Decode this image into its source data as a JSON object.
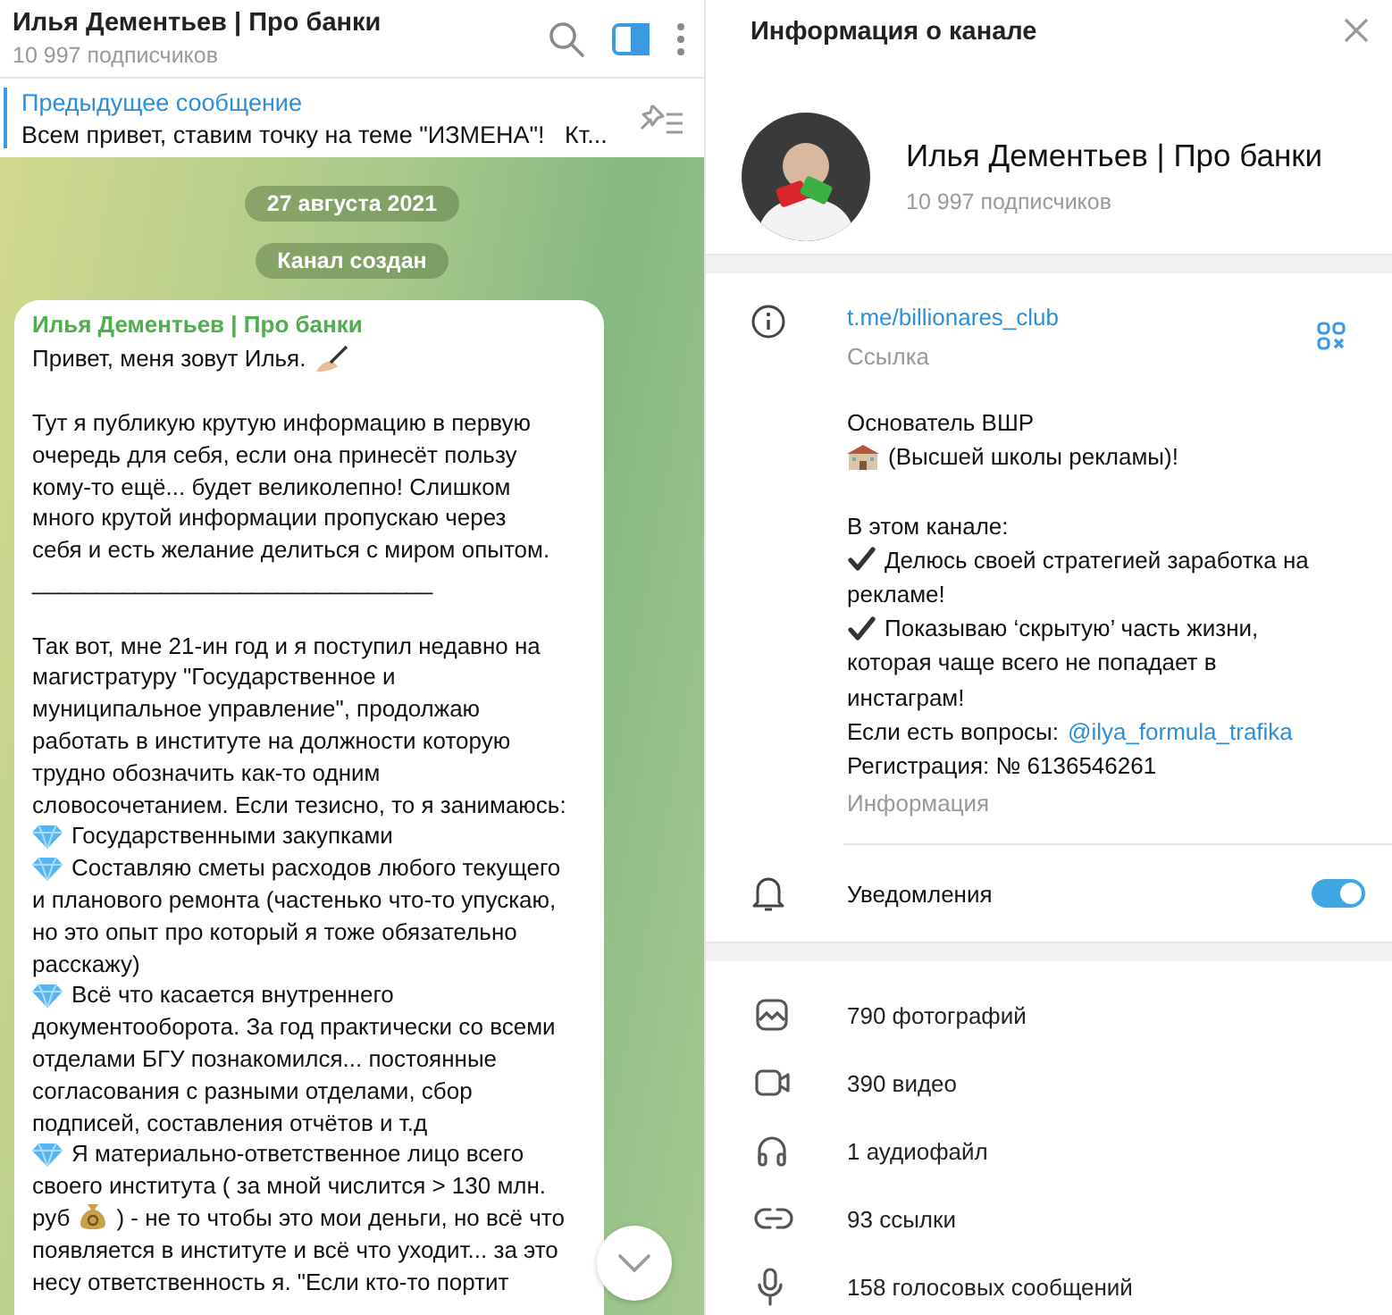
{
  "chat": {
    "title": "Илья Дементьев | Про банки",
    "subtitle": "10 997 подписчиков",
    "info_panel_open": true,
    "pinned": {
      "label": "Предыдущее сообщение",
      "text": "Всем привет, ставим точку на теме \"ИЗМЕНА\"!   Кт..."
    },
    "service_messages": [
      "27 августа 2021",
      "Канал создан"
    ],
    "message": {
      "author": "Илья Дементьев | Про банки",
      "paragraphs": [
        [
          {
            "kind": "hand",
            "text": "Привет, меня зовут Илья."
          }
        ],
        [
          {
            "kind": "text",
            "text": "Тут я публикую крутую информацию в первую"
          },
          {
            "kind": "text",
            "text": "очередь для себя, если она принесёт пользу"
          },
          {
            "kind": "text",
            "text": "кому-то ещё... будет великолепно! Слишком"
          },
          {
            "kind": "text",
            "text": "много крутой информации пропускаю через"
          },
          {
            "kind": "text",
            "text": "себя и есть желание делиться с миром опытом."
          },
          {
            "kind": "text",
            "text": "_______________________________"
          }
        ],
        [
          {
            "kind": "text",
            "text": "Так вот, мне 21-ин год и я поступил недавно на"
          },
          {
            "kind": "text",
            "text": "магистратуру \"Государственное и"
          },
          {
            "kind": "text",
            "text": "муниципальное управление\", продолжаю"
          },
          {
            "kind": "text",
            "text": "работать в институте на должности которую"
          },
          {
            "kind": "text",
            "text": "трудно обозначить как-то одним"
          },
          {
            "kind": "text",
            "text": "словосочетанием. Если тезисно, то я занимаюсь:"
          },
          {
            "kind": "bullet",
            "text": "Государственными закупками"
          },
          {
            "kind": "bullet",
            "text": "Составляю сметы расходов любого текущего"
          },
          {
            "kind": "text",
            "text": "и планового ремонта (частенько что-то упускаю,"
          },
          {
            "kind": "text",
            "text": "но это опыт про который я тоже обязательно"
          },
          {
            "kind": "text",
            "text": "расскажу)"
          },
          {
            "kind": "bullet",
            "text": "Всё что касается внутреннего"
          },
          {
            "kind": "text",
            "text": "документооборота. За год практически со всеми"
          },
          {
            "kind": "text",
            "text": "отделами БГУ познакомился... постоянные"
          },
          {
            "kind": "text",
            "text": "согласования с разными отделами, сбор"
          },
          {
            "kind": "text",
            "text": "подписей, составления отчётов и т.д"
          },
          {
            "kind": "bullet",
            "text": "Я материально-ответственное лицо всего"
          },
          {
            "kind": "text",
            "text": "своего института ( за мной числится > 130 млн."
          },
          {
            "kind": "money",
            "before": "руб",
            "after": ") - не то чтобы это мои деньги, но всё что"
          },
          {
            "kind": "text",
            "text": "появляется в институте и всё что уходит... за это"
          },
          {
            "kind": "text",
            "text": "несу ответственность я. \"Если кто-то портит"
          }
        ]
      ]
    }
  },
  "info": {
    "title": "Информация о канале",
    "channel": {
      "name": "Илья Дементьев | Про банки",
      "subscribers": "10 997 подписчиков"
    },
    "link": {
      "url": "t.me/billionares_club",
      "label": "Ссылка"
    },
    "description": {
      "paragraphs": [
        [
          {
            "kind": "text",
            "text": "Основатель ВШР"
          },
          {
            "kind": "school",
            "text": "(Высшей школы рекламы)!"
          }
        ],
        [
          {
            "kind": "text",
            "text": "В этом канале:"
          },
          {
            "kind": "check",
            "text": "Делюсь своей стратегией заработка на"
          },
          {
            "kind": "text",
            "text": "рекламе!"
          },
          {
            "kind": "check",
            "text": "Показываю ‘скрытую’ часть жизни,"
          },
          {
            "kind": "text",
            "text": "которая чаще всего не попадает в"
          },
          {
            "kind": "text",
            "text": "инстаграм!"
          },
          {
            "kind": "mention",
            "text": "Если есть вопросы:",
            "link": "@ilya_formula_trafika"
          },
          {
            "kind": "text",
            "text": "Регистрация: № 6136546261"
          }
        ]
      ],
      "label": "Информация"
    },
    "notifications": {
      "label": "Уведомления",
      "on": true
    },
    "media": [
      {
        "kind": "photos",
        "text": "790 фотографий"
      },
      {
        "kind": "videos",
        "text": "390 видео"
      },
      {
        "kind": "audio",
        "text": "1 аудиофайл"
      },
      {
        "kind": "links",
        "text": "93 ссылки"
      },
      {
        "kind": "voice",
        "text": "158 голосовых сообщений"
      }
    ]
  }
}
